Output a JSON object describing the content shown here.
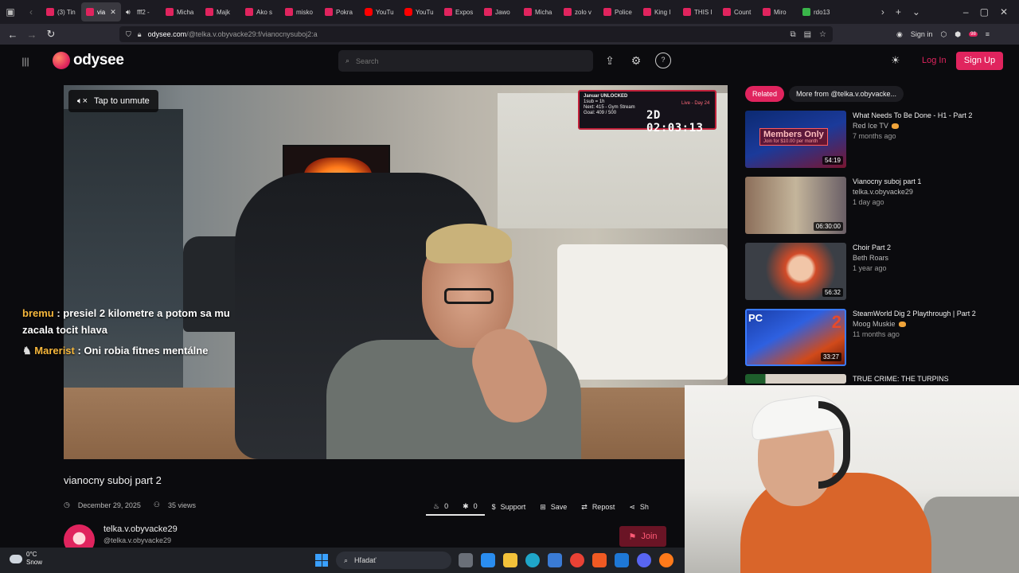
{
  "browser": {
    "tabs": [
      {
        "label": "(3) Tin",
        "fav": "pink"
      },
      {
        "label": "via",
        "fav": "pink",
        "active": true
      },
      {
        "label": "fff2 -",
        "fav": "spk"
      },
      {
        "label": "Micha",
        "fav": "pink"
      },
      {
        "label": "Majk",
        "fav": "pink"
      },
      {
        "label": "Ako s",
        "fav": "pink"
      },
      {
        "label": "misko",
        "fav": "pink"
      },
      {
        "label": "Pokra",
        "fav": "pink"
      },
      {
        "label": "YouTu",
        "fav": "yt"
      },
      {
        "label": "YouTu",
        "fav": "yt"
      },
      {
        "label": "Expos",
        "fav": "pink"
      },
      {
        "label": "Jawo",
        "fav": "pink"
      },
      {
        "label": "Micha",
        "fav": "pink"
      },
      {
        "label": "zolo v",
        "fav": "pink"
      },
      {
        "label": "Police",
        "fav": "pink"
      },
      {
        "label": "King I",
        "fav": "pink"
      },
      {
        "label": "THIS I",
        "fav": "pink"
      },
      {
        "label": "Count",
        "fav": "pink"
      },
      {
        "label": "Miro",
        "fav": "pink"
      },
      {
        "label": "rdo13",
        "fav": "green"
      }
    ],
    "url_domain": "odysee.com",
    "url_path": "/@telka.v.obyvacke29:f/vianocnysuboj2:a",
    "sign_in": "Sign in",
    "ext_badge": "98"
  },
  "header": {
    "logo": "odysee",
    "search_placeholder": "Search",
    "login": "Log In",
    "signup": "Sign Up"
  },
  "video": {
    "unmute": "Tap to unmute",
    "overlay": {
      "line1": "Januar UNLOCKED",
      "line2": "1sub = 1h",
      "line3": "Next: 415 - Gym Stream",
      "line4": "Goal: 409 / 500",
      "live": "Live - Day 24",
      "timer": "2D 02:03:13"
    },
    "chat": [
      {
        "user": "bremu",
        "text": ": presiel 2 kilometre a potom sa mu zacala tocit hlava"
      },
      {
        "user": "Marerist",
        "text": ": Oni robia fitnes mentálne"
      }
    ]
  },
  "details": {
    "title": "vianocny suboj part 2",
    "date": "December 29, 2025",
    "views": "35 views",
    "fire_count": "0",
    "slime_count": "0",
    "support": "Support",
    "save": "Save",
    "repost": "Repost",
    "share": "Sh",
    "channel_name": "telka.v.obyvacke29",
    "channel_handle": "@telka.v.obyvacke29",
    "join": "Join"
  },
  "sidebar": {
    "tab_related": "Related",
    "tab_more": "More from @telka.v.obyvacke...",
    "items": [
      {
        "title": "What Needs To Be Done - H1 - Part 2",
        "channel": "Red Ice TV",
        "coin": true,
        "ago": "7 months ago",
        "duration": "54:19",
        "members": "Members Only",
        "members_sub": "Join for $10.00 per month"
      },
      {
        "title": "Vianocny suboj part 1",
        "channel": "telka.v.obyvacke29",
        "coin": false,
        "ago": "1 day ago",
        "duration": "06:30:00"
      },
      {
        "title": "Choir Part 2",
        "channel": "Beth Roars",
        "coin": false,
        "ago": "1 year ago",
        "duration": "56:32"
      },
      {
        "title": "SteamWorld Dig 2 Playthrough | Part 2",
        "channel": "Moog Muskie",
        "coin": true,
        "ago": "11 months ago",
        "duration": "33:27",
        "badge": "PC",
        "num": "2"
      },
      {
        "title": "TRUE CRIME: THE TURPINS",
        "channel": "",
        "coin": false,
        "ago": "",
        "duration": ""
      }
    ]
  },
  "taskbar": {
    "temp": "0°C",
    "weather": "Snow",
    "search": "Hľadať"
  }
}
